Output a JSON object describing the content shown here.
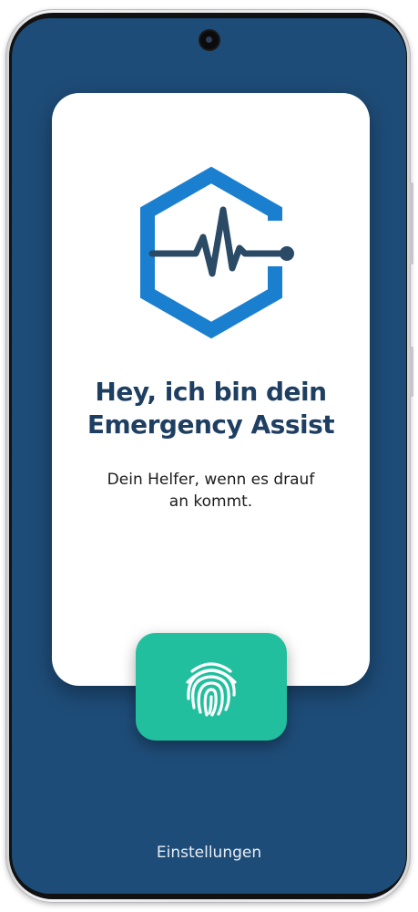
{
  "welcome": {
    "headline_line1": "Hey, ich bin dein",
    "headline_line2": "Emergency Assist",
    "subtitle_line1": "Dein Helfer, wenn es drauf",
    "subtitle_line2": "an kommt."
  },
  "logo": {
    "icon": "heartbeat-hexagon-icon",
    "hex_color": "#1b7fcf",
    "pulse_color": "#2b4a66"
  },
  "unlock": {
    "icon": "fingerprint-icon",
    "color": "#22bf9e"
  },
  "footer": {
    "settings_label": "Einstellungen"
  },
  "colors": {
    "background": "#1e4c78",
    "card": "#ffffff",
    "headline": "#1f3f62"
  }
}
